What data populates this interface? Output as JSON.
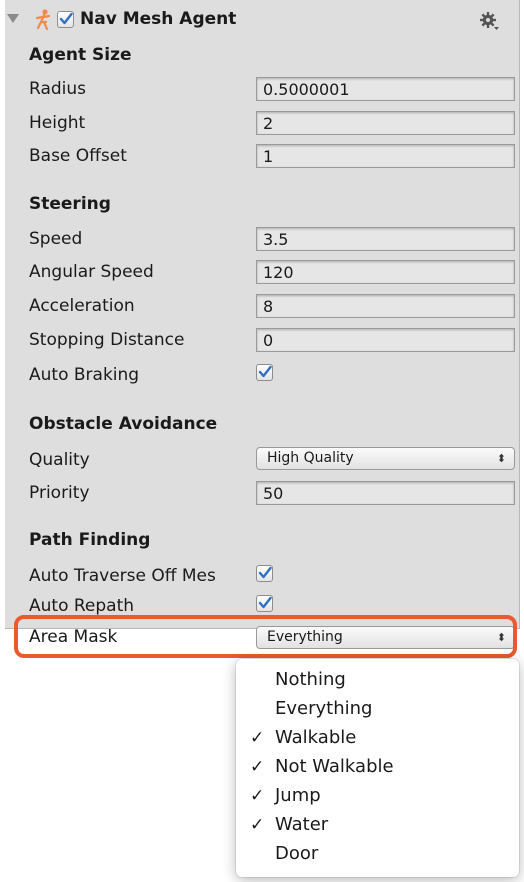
{
  "component": {
    "title": "Nav Mesh Agent",
    "enabled": true
  },
  "agent_size": {
    "heading": "Agent Size",
    "radius_label": "Radius",
    "radius_value": "0.5000001",
    "height_label": "Height",
    "height_value": "2",
    "base_offset_label": "Base Offset",
    "base_offset_value": "1"
  },
  "steering": {
    "heading": "Steering",
    "speed_label": "Speed",
    "speed_value": "3.5",
    "angular_speed_label": "Angular Speed",
    "angular_speed_value": "120",
    "acceleration_label": "Acceleration",
    "acceleration_value": "8",
    "stopping_distance_label": "Stopping Distance",
    "stopping_distance_value": "0",
    "auto_braking_label": "Auto Braking",
    "auto_braking": true
  },
  "obstacle_avoidance": {
    "heading": "Obstacle Avoidance",
    "quality_label": "Quality",
    "quality_value": "High Quality",
    "priority_label": "Priority",
    "priority_value": "50"
  },
  "path_finding": {
    "heading": "Path Finding",
    "auto_traverse_label": "Auto Traverse Off Mes",
    "auto_traverse": true,
    "auto_repath_label": "Auto Repath",
    "auto_repath": true,
    "area_mask_label": "Area Mask",
    "area_mask_value": "Everything"
  },
  "dropdown_arrows": "⬍",
  "area_mask_menu": {
    "items": [
      {
        "label": "Nothing",
        "checked": false,
        "check": ""
      },
      {
        "label": "Everything",
        "checked": false,
        "check": ""
      },
      {
        "label": "Walkable",
        "checked": true,
        "check": "✓"
      },
      {
        "label": "Not Walkable",
        "checked": true,
        "check": "✓"
      },
      {
        "label": "Jump",
        "checked": true,
        "check": "✓"
      },
      {
        "label": "Water",
        "checked": true,
        "check": "✓"
      },
      {
        "label": "Door",
        "checked": false,
        "check": ""
      }
    ]
  },
  "colors": {
    "panel_bg": "#dedede",
    "highlight": "#ea5a2e",
    "checkmark": "#2f6fc4",
    "agent_icon": "#f08a4b"
  }
}
